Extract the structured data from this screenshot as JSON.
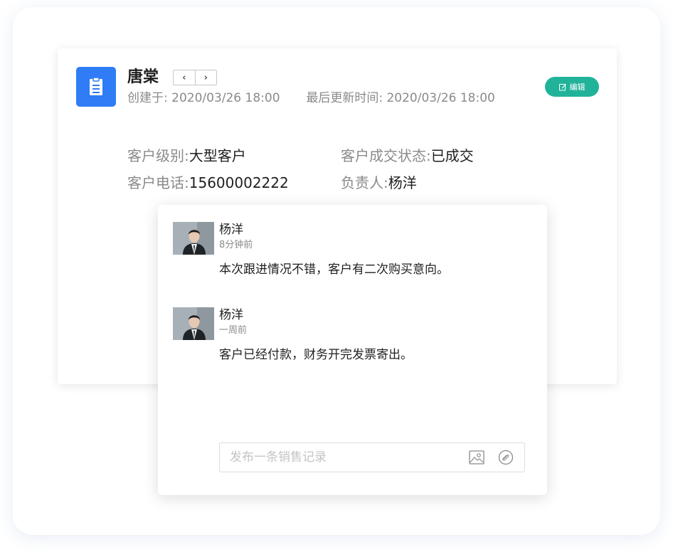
{
  "customer": {
    "name": "唐棠",
    "created_label": "创建于:",
    "created_at": "2020/03/26 18:00",
    "updated_label": "最后更新时间:",
    "updated_at": "2020/03/26 18:00",
    "edit_label": "编辑",
    "nav_prev": "‹",
    "nav_next": "›",
    "fields": {
      "level_label": "客户级别:",
      "level_value": "大型客户",
      "deal_status_label": "客户成交状态:",
      "deal_status_value": "已成交",
      "phone_label": "客户电话:",
      "phone_value": "15600002222",
      "owner_label": "负责人:",
      "owner_value": "杨洋"
    }
  },
  "comments": [
    {
      "author": "杨洋",
      "time": "8分钟前",
      "text": "本次跟进情况不错，客户有二次购买意向。"
    },
    {
      "author": "杨洋",
      "time": "一周前",
      "text": "客户已经付款，财务开完发票寄出。"
    }
  ],
  "composer": {
    "placeholder": "发布一条销售记录"
  },
  "colors": {
    "primary": "#2f7cf6",
    "edit_button": "#21b39a"
  },
  "icons": {
    "doc": "document-icon",
    "edit": "edit-icon",
    "image": "image-icon",
    "attach": "attachment-icon"
  }
}
